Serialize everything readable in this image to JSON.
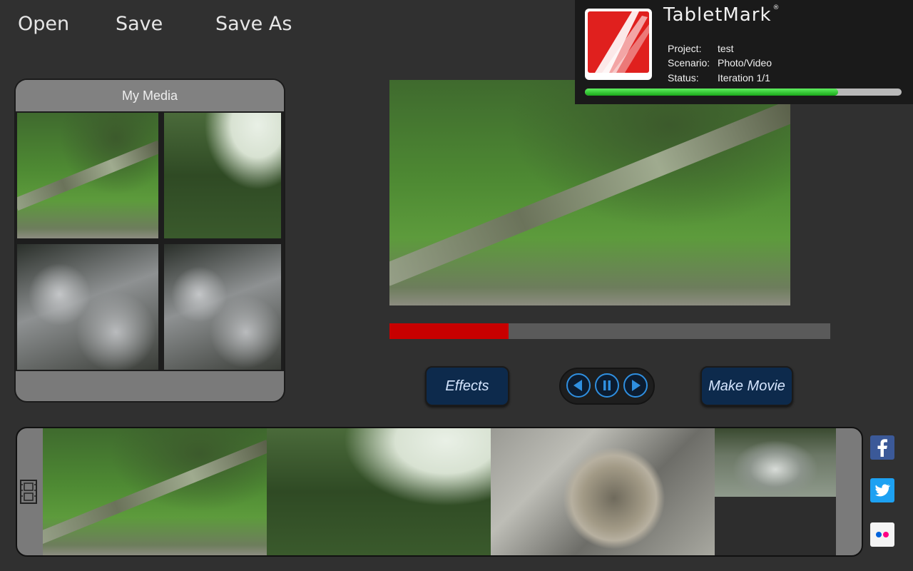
{
  "menu": {
    "open": "Open",
    "save": "Save",
    "save_as": "Save As"
  },
  "tabletmark": {
    "brand": "TabletMark",
    "project_label": "Project:",
    "project_value": "test",
    "scenario_label": "Scenario:",
    "scenario_value": "Photo/Video",
    "status_label": "Status:",
    "status_value": "Iteration 1/1",
    "progress": 0.8
  },
  "media": {
    "title": "My Media"
  },
  "playback": {
    "progress": 0.27
  },
  "controls": {
    "effects": "Effects",
    "make_movie": "Make Movie"
  },
  "icons": {
    "film": "film-strip-icon",
    "prev": "previous-icon",
    "pause": "pause-icon",
    "next": "next-icon",
    "facebook": "facebook-icon",
    "twitter": "twitter-icon",
    "flickr": "flickr-icon"
  },
  "colors": {
    "accent_blue": "#2f8fe0",
    "button_navy": "#0d2a4c",
    "progress_red": "#c80000",
    "progress_green": "#1aa71a",
    "tm_red": "#e0201e",
    "facebook": "#3b5998",
    "twitter": "#1da1f2"
  }
}
